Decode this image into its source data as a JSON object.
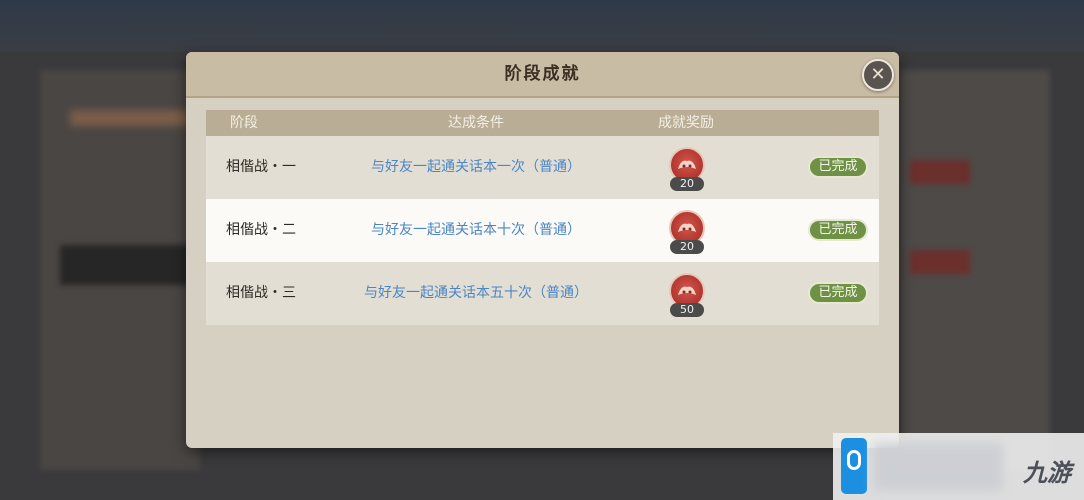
{
  "dialog": {
    "title": "阶段成就",
    "close_icon": "close-x-icon"
  },
  "table": {
    "headers": {
      "stage": "阶段",
      "condition": "达成条件",
      "reward": "成就奖励"
    },
    "rows": [
      {
        "stage": "相偕战・一",
        "condition": "与好友一起通关话本一次（普通）",
        "reward_icon": "red-token-icon",
        "reward_count": "20",
        "status": "已完成"
      },
      {
        "stage": "相偕战・二",
        "condition": "与好友一起通关话本十次（普通）",
        "reward_icon": "red-token-icon",
        "reward_count": "20",
        "status": "已完成"
      },
      {
        "stage": "相偕战・三",
        "condition": "与好友一起通关话本五十次（普通）",
        "reward_icon": "red-token-icon",
        "reward_count": "50",
        "status": "已完成"
      }
    ]
  },
  "watermark": {
    "text": "九游"
  },
  "colors": {
    "status_green": "#6f9146",
    "condition_blue": "#4b86c4",
    "reward_red": "#b63a33"
  }
}
